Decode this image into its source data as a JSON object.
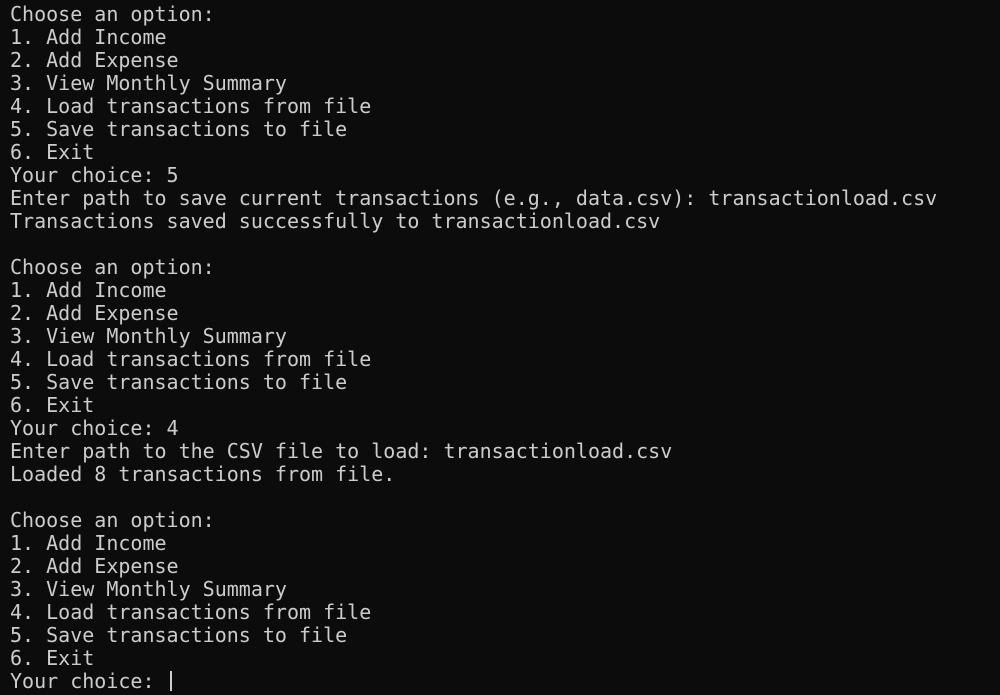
{
  "terminal": {
    "lines": [
      "Choose an option:",
      "1. Add Income",
      "2. Add Expense",
      "3. View Monthly Summary",
      "4. Load transactions from file",
      "5. Save transactions to file",
      "6. Exit",
      "Your choice: 5",
      "Enter path to save current transactions (e.g., data.csv): transactionload.csv",
      "Transactions saved successfully to transactionload.csv",
      "",
      "Choose an option:",
      "1. Add Income",
      "2. Add Expense",
      "3. View Monthly Summary",
      "4. Load transactions from file",
      "5. Save transactions to file",
      "6. Exit",
      "Your choice: 4",
      "Enter path to the CSV file to load: transactionload.csv",
      "Loaded 8 transactions from file.",
      "",
      "Choose an option:",
      "1. Add Income",
      "2. Add Expense",
      "3. View Monthly Summary",
      "4. Load transactions from file",
      "5. Save transactions to file",
      "6. Exit"
    ],
    "prompt": "Your choice: ",
    "input_value": ""
  },
  "colors": {
    "background": "#0c0c0c",
    "foreground": "#cccccc"
  }
}
